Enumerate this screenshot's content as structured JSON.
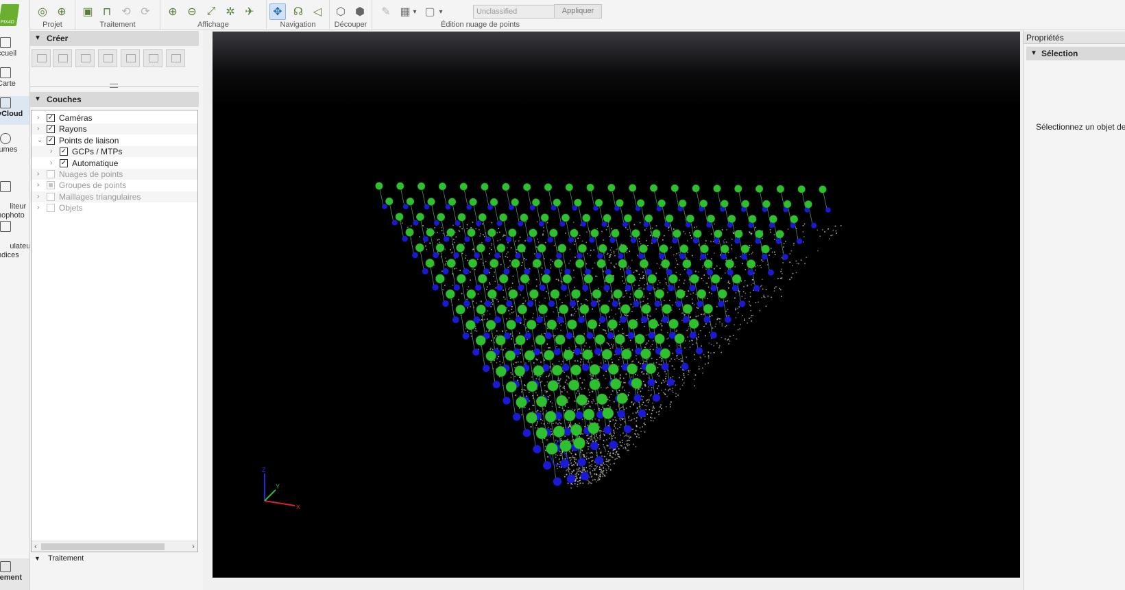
{
  "rail": {
    "logo_text": "PIX4D",
    "items": [
      {
        "label": "Accueil",
        "display": "ccueil",
        "icon": "home-icon"
      },
      {
        "label": "Carte",
        "display": "Carte",
        "icon": "map-icon"
      },
      {
        "label": "rayCloud",
        "display": "yCloud",
        "icon": "raycloud-icon",
        "active": true
      },
      {
        "label": "Volumes",
        "display": "lumes",
        "icon": "volumes-icon"
      },
      {
        "label": "Éditeur d'orthophoto",
        "display": "liteur\nhophoto",
        "icon": "ortho-editor-icon"
      },
      {
        "label": "Calculateur d'indices",
        "display": "ulateur\nndices",
        "icon": "index-calculator-icon"
      },
      {
        "label": "Traitement",
        "display": "tement",
        "icon": "processing-icon"
      }
    ]
  },
  "toolbar": {
    "groups": [
      "Projet",
      "Traitement",
      "Affichage",
      "Navigation",
      "Découper",
      "Édition nuage de points"
    ],
    "class_select_value": "Unclassified",
    "apply_label": "Appliquer"
  },
  "left_panel": {
    "create_title": "Créer",
    "layers_title": "Couches",
    "layers": [
      {
        "label": "Caméras",
        "checked": true,
        "enabled": true,
        "expanded": false,
        "level": 0
      },
      {
        "label": "Rayons",
        "checked": true,
        "enabled": true,
        "expanded": false,
        "level": 0
      },
      {
        "label": "Points de liaison",
        "checked": true,
        "enabled": true,
        "expanded": true,
        "level": 0
      },
      {
        "label": "GCPs / MTPs",
        "checked": true,
        "enabled": true,
        "expanded": false,
        "level": 1
      },
      {
        "label": "Automatique",
        "checked": true,
        "enabled": true,
        "expanded": false,
        "level": 1
      },
      {
        "label": "Nuages de points",
        "checked": false,
        "enabled": false,
        "expanded": false,
        "level": 0
      },
      {
        "label": "Groupes de points",
        "checked": "partial",
        "enabled": false,
        "expanded": false,
        "level": 0
      },
      {
        "label": "Maillages triangulaires",
        "checked": false,
        "enabled": false,
        "expanded": false,
        "level": 0
      },
      {
        "label": "Objets",
        "checked": false,
        "enabled": false,
        "expanded": false,
        "level": 0
      }
    ]
  },
  "bottom_dock": {
    "title": "Traitement",
    "close": "×"
  },
  "viewport": {
    "axis_labels": {
      "x": "X",
      "y": "Y",
      "z": "Z"
    },
    "colors": {
      "camera": "#2ec02e",
      "gcp": "#1a1ad6",
      "cloud": "#c9c4bc",
      "axis_x": "#e0202a",
      "axis_y": "#2ec02e",
      "axis_z": "#2626e0"
    }
  },
  "properties": {
    "title": "Propriétés",
    "section": "Sélection",
    "message": "Sélectionnez un objet depuis"
  }
}
